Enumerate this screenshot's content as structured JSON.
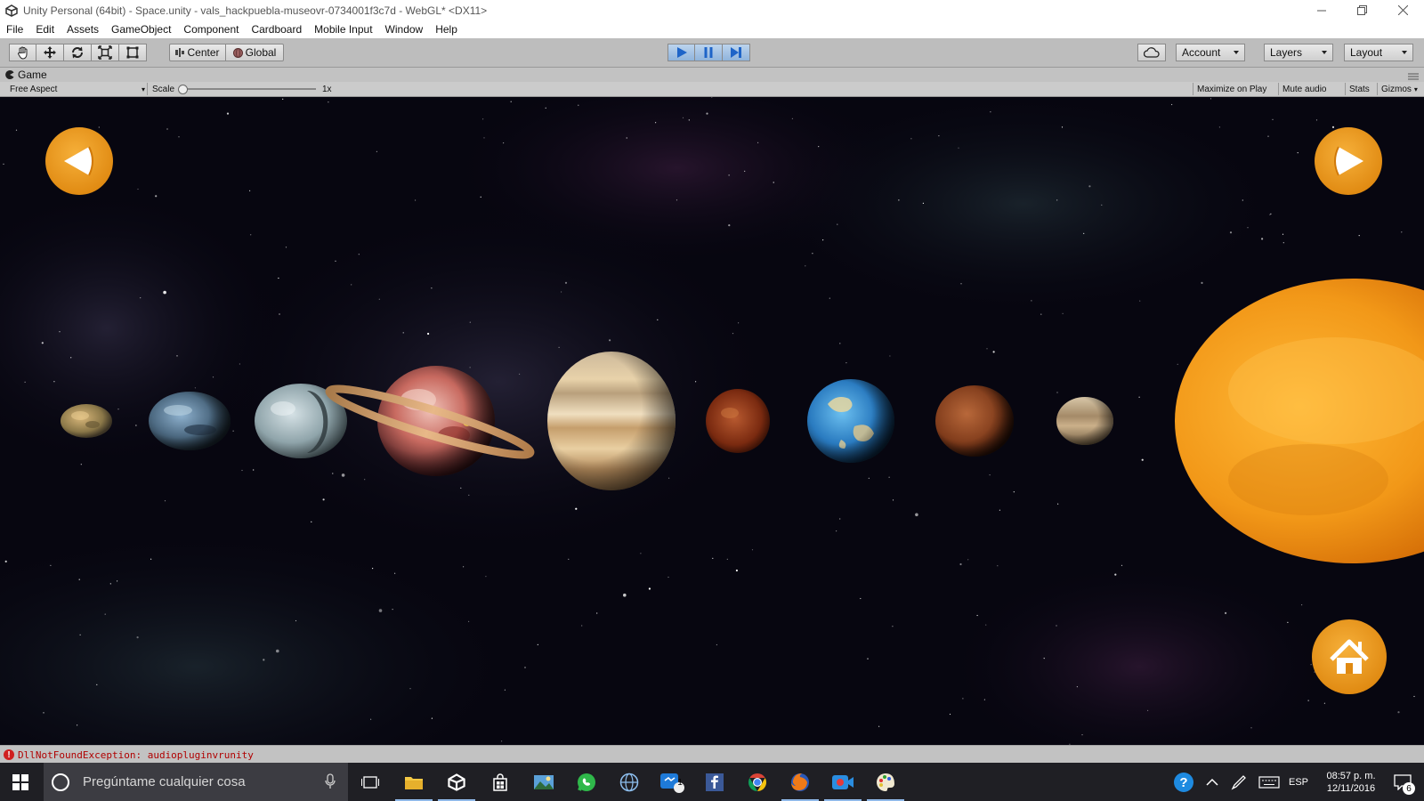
{
  "window": {
    "title": "Unity Personal (64bit) - Space.unity - vals_hackpuebla-museovr-0734001f3c7d - WebGL* <DX11>"
  },
  "menu": [
    "File",
    "Edit",
    "Assets",
    "GameObject",
    "Component",
    "Cardboard",
    "Mobile Input",
    "Window",
    "Help"
  ],
  "toolbar": {
    "pivot_label": "Center",
    "space_label": "Global",
    "account_label": "Account",
    "layers_label": "Layers",
    "layout_label": "Layout"
  },
  "game_tab": {
    "label": "Game",
    "aspect": "Free Aspect",
    "scale_label": "Scale",
    "scale_value": 0,
    "scale_text": "1x",
    "maximize_label": "Maximize on Play",
    "mute_label": "Mute audio",
    "stats_label": "Stats",
    "gizmos_label": "Gizmos"
  },
  "scene": {
    "back_icon": "back-arrow-icon",
    "forward_icon": "forward-arrow-icon",
    "home_icon": "home-icon",
    "button_color": "#f2a020"
  },
  "status": {
    "error_message": "DllNotFoundException: audiopluginvrunity"
  },
  "taskbar": {
    "search_placeholder": "Pregúntame cualquier cosa",
    "language": "ESP",
    "time": "08:57 p. m.",
    "date": "12/11/2016",
    "notifications": "6",
    "messenger_badge": "1"
  }
}
